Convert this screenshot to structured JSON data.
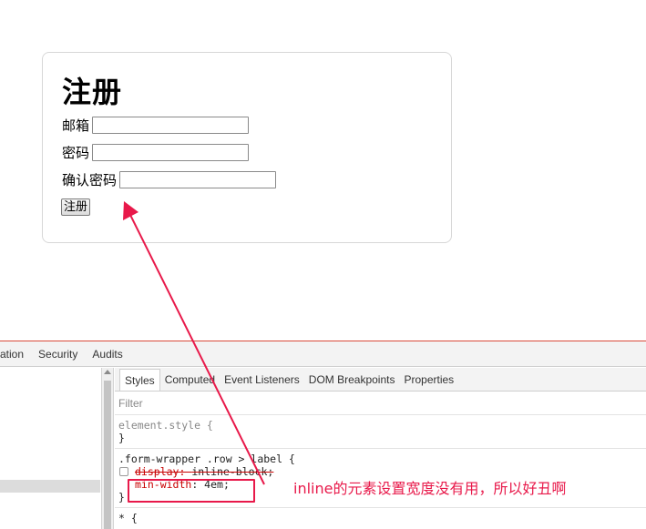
{
  "form": {
    "title": "注册",
    "email_label": "邮箱",
    "password_label": "密码",
    "confirm_label": "确认密码",
    "submit_label": "注册"
  },
  "devtools": {
    "main_tabs": [
      "ation",
      "Security",
      "Audits"
    ],
    "sub_tabs": [
      "Styles",
      "Computed",
      "Event Listeners",
      "DOM Breakpoints",
      "Properties"
    ],
    "filter_placeholder": "Filter",
    "element_style_selector": "element.style {",
    "close_brace": "}",
    "rule_selector": ".form-wrapper .row > label {",
    "prop1_name": "display",
    "prop1_value": "inline-block;",
    "prop2_name": "min-width",
    "prop2_value": "4em;",
    "universal_selector": "* {"
  },
  "annotation": {
    "text": "inline的元素设置宽度没有用，所以好丑啊",
    "color": "#e8194a"
  }
}
